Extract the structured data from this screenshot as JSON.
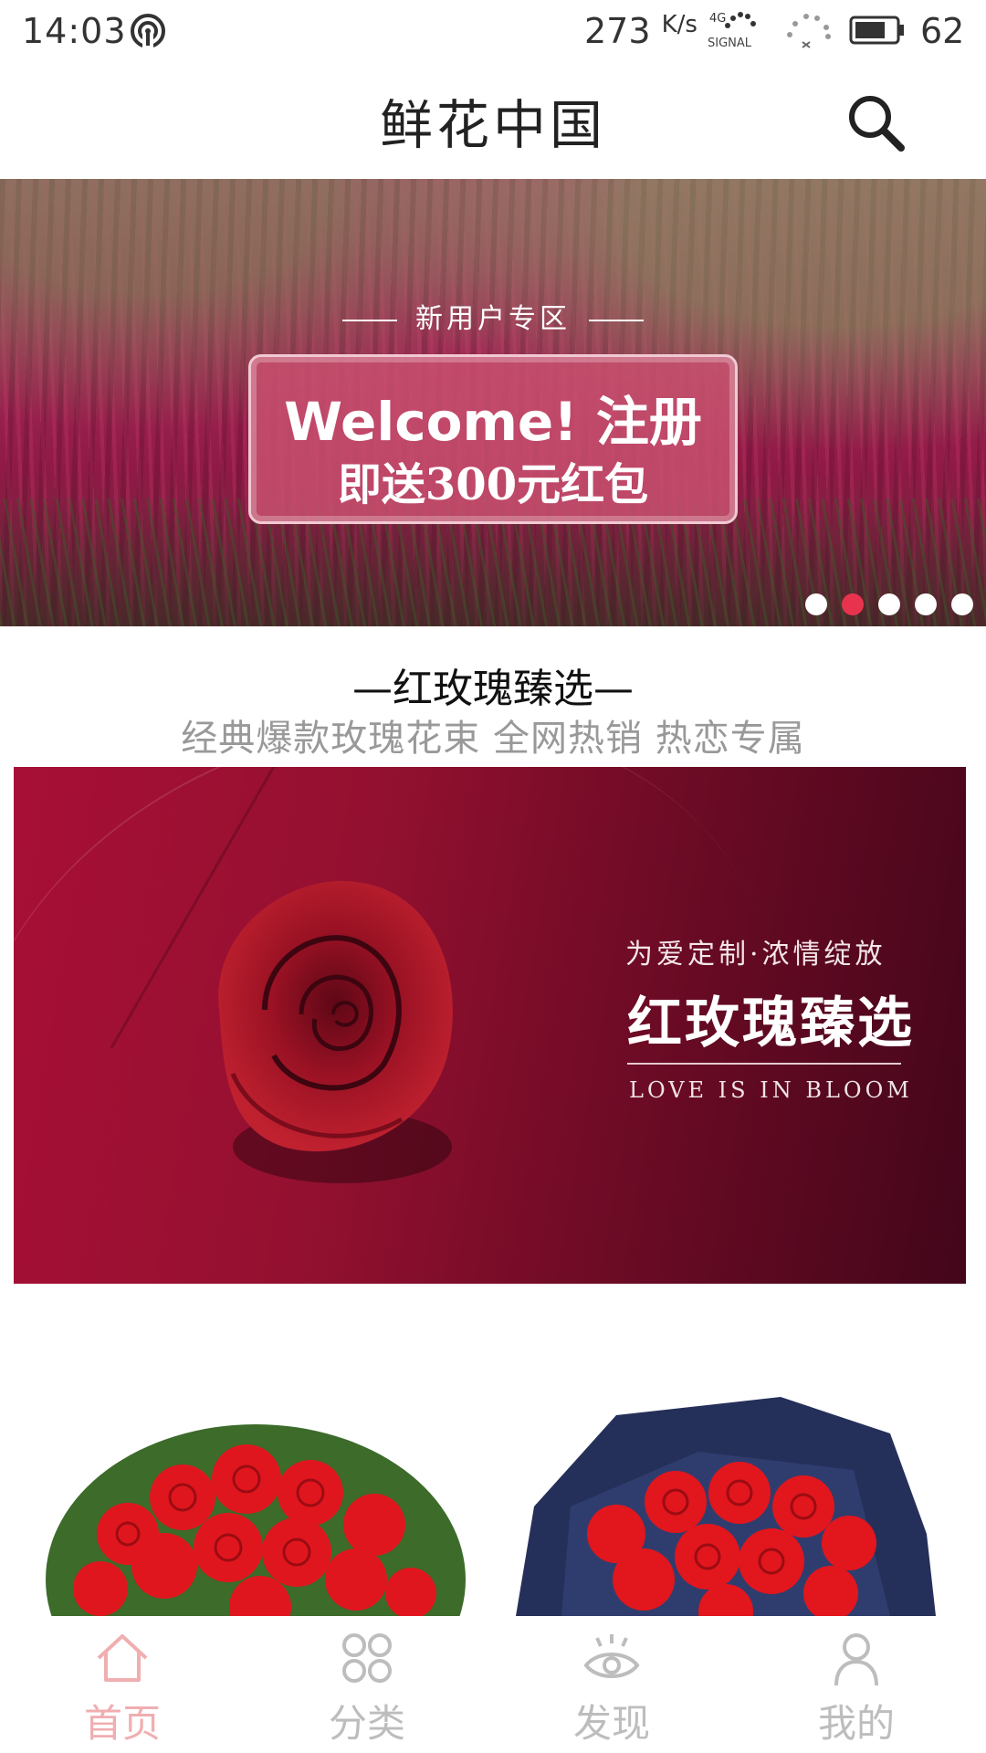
{
  "status_bar": {
    "time": "14:03",
    "net_speed": "273",
    "net_unit": "K/s",
    "network_label": "SIGNAL",
    "network_type": "4G",
    "battery": "62",
    "icons": [
      "hotspot-icon",
      "signal-4g-icon",
      "wifi-icon",
      "battery-icon"
    ]
  },
  "header": {
    "title": "鲜花中国",
    "search_icon": "search-icon"
  },
  "banner": {
    "subtitle": "新用户专区",
    "line1": "Welcome! 注册",
    "line2": "即送300元红包",
    "dot_count": 5,
    "active_dot": 1
  },
  "section": {
    "title": "—红玫瑰臻选—",
    "subtitle": "经典爆款玫瑰花束 全网热销 热恋专属"
  },
  "promo": {
    "tagline": "为爱定制·浓情绽放",
    "title": "红玫瑰臻选",
    "english": "LOVE IS IN BLOOM"
  },
  "tabs": [
    {
      "label": "首页",
      "icon": "home-icon",
      "active": true
    },
    {
      "label": "分类",
      "icon": "category-icon",
      "active": false
    },
    {
      "label": "发现",
      "icon": "eye-icon",
      "active": false
    },
    {
      "label": "我的",
      "icon": "user-icon",
      "active": false
    }
  ],
  "colors": {
    "accent": "#e8334e",
    "tab_active": "#f0aeb0",
    "tab_inactive": "#bdbdbd",
    "promo_bg": "#941030"
  }
}
